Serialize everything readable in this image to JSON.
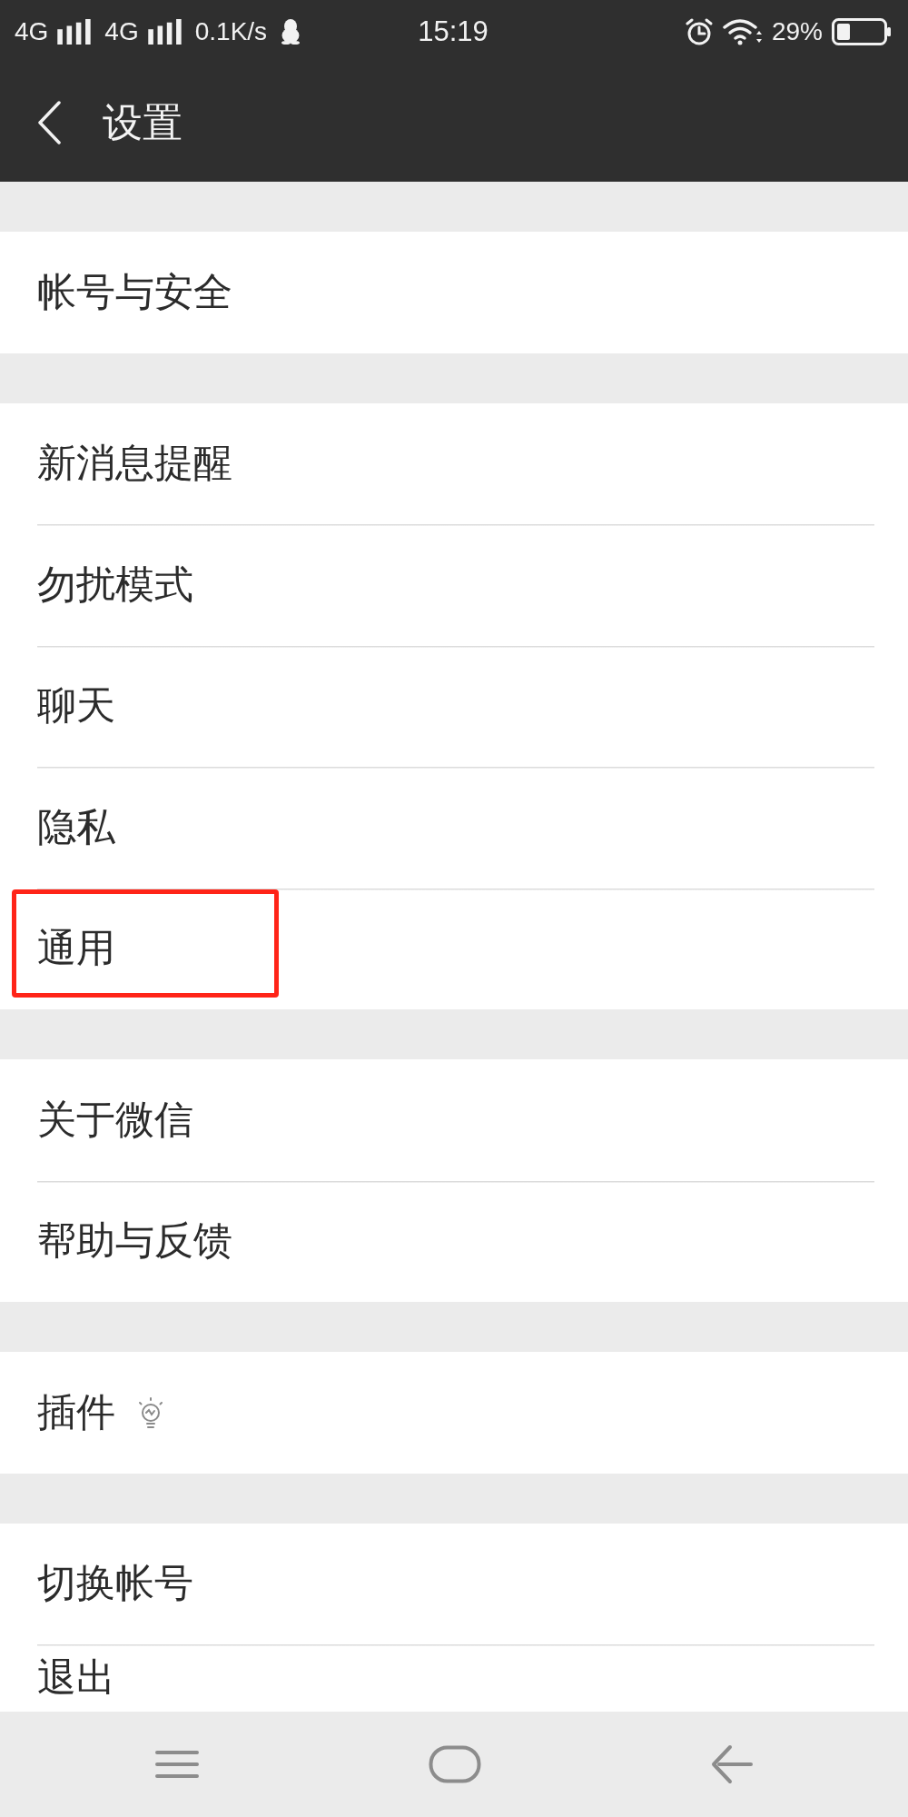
{
  "status_bar": {
    "network_1": "4G",
    "network_2": "4G",
    "speed": "0.1K/s",
    "time": "15:19",
    "battery": "29%"
  },
  "header": {
    "title": "设置"
  },
  "groups": [
    {
      "items": [
        {
          "label": "帐号与安全",
          "kind": "plain",
          "highlighted": false
        }
      ]
    },
    {
      "items": [
        {
          "label": "新消息提醒",
          "kind": "plain",
          "highlighted": false
        },
        {
          "label": "勿扰模式",
          "kind": "plain",
          "highlighted": false
        },
        {
          "label": "聊天",
          "kind": "plain",
          "highlighted": false
        },
        {
          "label": "隐私",
          "kind": "plain",
          "highlighted": false
        },
        {
          "label": "通用",
          "kind": "plain",
          "highlighted": true
        }
      ]
    },
    {
      "items": [
        {
          "label": "关于微信",
          "kind": "plain",
          "highlighted": false
        },
        {
          "label": "帮助与反馈",
          "kind": "plain",
          "highlighted": false
        }
      ]
    },
    {
      "items": [
        {
          "label": "插件",
          "kind": "with-icon",
          "highlighted": false
        }
      ]
    },
    {
      "items": [
        {
          "label": "切换帐号",
          "kind": "plain",
          "highlighted": false
        },
        {
          "label": "退出",
          "kind": "plain",
          "highlighted": false
        }
      ]
    }
  ]
}
